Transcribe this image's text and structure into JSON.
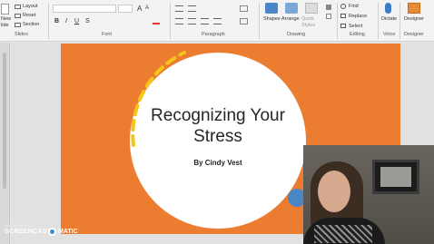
{
  "ribbon": {
    "slides": {
      "new_label": "New",
      "slide_label": "lide",
      "layout_label": "Layout",
      "reset_label": "Reset",
      "section_label": "Section",
      "group_label": "Slides"
    },
    "font": {
      "group_label": "Font",
      "bold": "B",
      "italic": "I",
      "underline": "U",
      "strike": "S",
      "size_up": "A",
      "size_down": "A"
    },
    "paragraph": {
      "group_label": "Paragraph"
    },
    "drawing": {
      "shapes_label": "Shapes",
      "arrange_label": "Arrange",
      "quick_styles_label": "Quick Styles",
      "group_label": "Drawing"
    },
    "editing": {
      "find_label": "Find",
      "replace_label": "Replace",
      "select_label": "Select",
      "group_label": "Editing"
    },
    "voice": {
      "dictate_label": "Dictate",
      "group_label": "Voice"
    },
    "designer": {
      "designer_label": "Designer",
      "group_label": "Designer"
    }
  },
  "slide": {
    "title": "Recognizing Your Stress",
    "subtitle": "By Cindy Vest"
  },
  "watermark": {
    "recorded_with": "RECORDED WITH",
    "brand_a": "SCREENCAST",
    "brand_b": "MATIC"
  },
  "colors": {
    "slide_bg": "#ec7c30",
    "accent_dashes": "#f5c518",
    "blue_dot": "#4a86c5"
  }
}
